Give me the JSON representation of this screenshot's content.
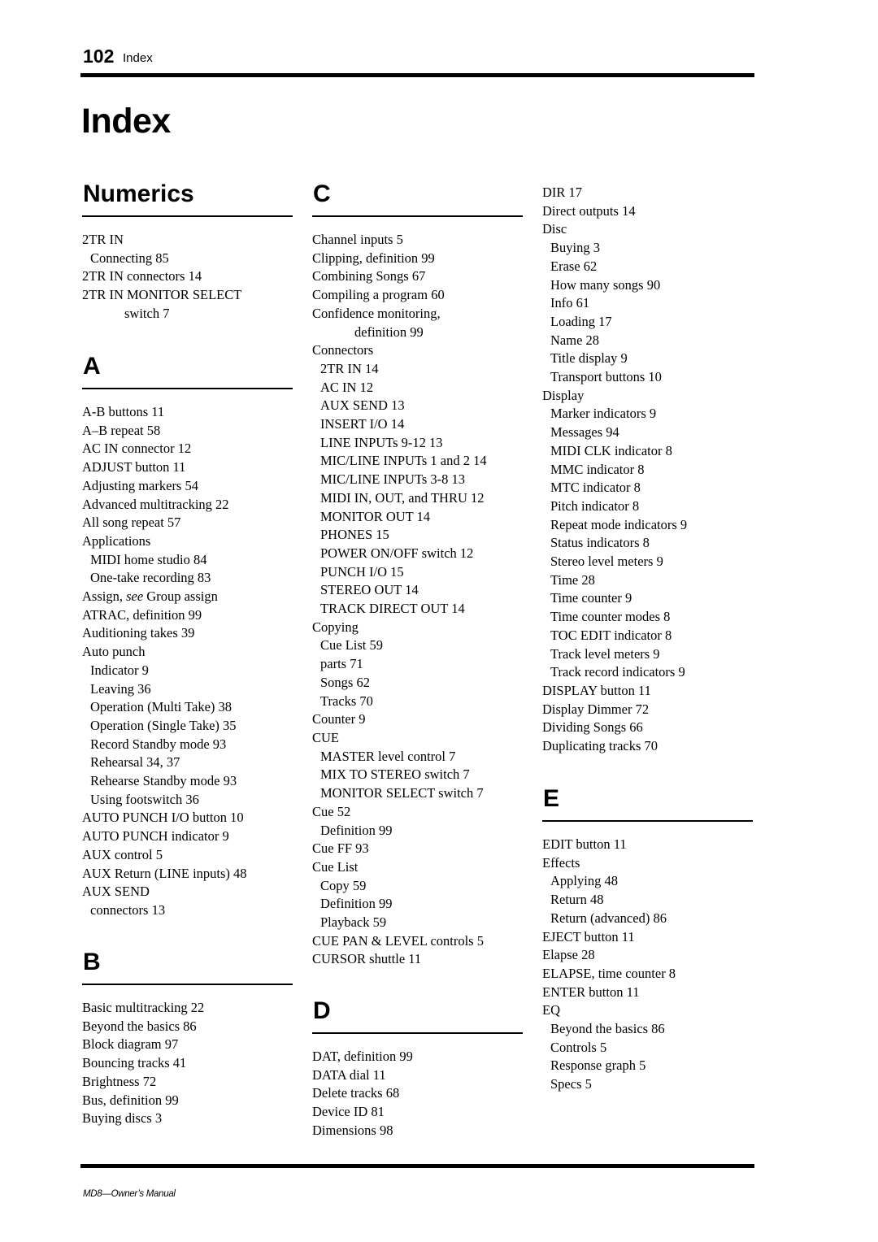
{
  "header": {
    "page_number": "102",
    "section_label": "Index"
  },
  "page_title": "Index",
  "footer": "MD8—Owner’s Manual",
  "sections": {
    "numerics": {
      "heading": "Numerics",
      "entries": [
        {
          "text": "2TR IN",
          "level": 0
        },
        {
          "text": "Connecting 85",
          "level": 1
        },
        {
          "text": "2TR IN connectors 14",
          "level": 0
        },
        {
          "text": "2TR IN MONITOR SELECT",
          "level": 0
        },
        {
          "text": "switch 7",
          "level": 2
        }
      ]
    },
    "a": {
      "heading": "A",
      "entries": [
        {
          "text": "A-B buttons 11",
          "level": 0
        },
        {
          "text": "A–B repeat 58",
          "level": 0
        },
        {
          "text": "AC IN connector 12",
          "level": 0
        },
        {
          "text": "ADJUST button 11",
          "level": 0
        },
        {
          "text": "Adjusting markers 54",
          "level": 0
        },
        {
          "text": "Advanced multitracking 22",
          "level": 0
        },
        {
          "text": "All song repeat 57",
          "level": 0
        },
        {
          "text": "Applications",
          "level": 0
        },
        {
          "text": "MIDI home studio 84",
          "level": 1
        },
        {
          "text": "One-take recording 83",
          "level": 1
        },
        {
          "text": "Assign, see Group assign",
          "level": 0,
          "pre": "Assign, ",
          "italic": "see",
          "post": " Group assign"
        },
        {
          "text": "ATRAC, definition 99",
          "level": 0
        },
        {
          "text": "Auditioning takes 39",
          "level": 0
        },
        {
          "text": "Auto punch",
          "level": 0
        },
        {
          "text": "Indicator 9",
          "level": 1
        },
        {
          "text": "Leaving 36",
          "level": 1
        },
        {
          "text": "Operation (Multi Take) 38",
          "level": 1
        },
        {
          "text": "Operation (Single Take) 35",
          "level": 1
        },
        {
          "text": "Record Standby mode 93",
          "level": 1
        },
        {
          "text": "Rehearsal 34, 37",
          "level": 1
        },
        {
          "text": "Rehearse Standby mode 93",
          "level": 1
        },
        {
          "text": "Using footswitch 36",
          "level": 1
        },
        {
          "text": "AUTO PUNCH I/O button 10",
          "level": 0
        },
        {
          "text": "AUTO PUNCH indicator 9",
          "level": 0
        },
        {
          "text": "AUX control 5",
          "level": 0
        },
        {
          "text": "AUX Return (LINE inputs) 48",
          "level": 0
        },
        {
          "text": "AUX SEND",
          "level": 0
        },
        {
          "text": "connectors 13",
          "level": 1
        }
      ]
    },
    "b": {
      "heading": "B",
      "entries": [
        {
          "text": "Basic multitracking 22",
          "level": 0
        },
        {
          "text": "Beyond the basics 86",
          "level": 0
        },
        {
          "text": "Block diagram 97",
          "level": 0
        },
        {
          "text": "Bouncing tracks 41",
          "level": 0
        },
        {
          "text": "Brightness 72",
          "level": 0
        },
        {
          "text": "Bus, definition 99",
          "level": 0
        },
        {
          "text": "Buying discs 3",
          "level": 0
        }
      ]
    },
    "c": {
      "heading": "C",
      "entries": [
        {
          "text": "Channel inputs 5",
          "level": 0
        },
        {
          "text": "Clipping, definition 99",
          "level": 0
        },
        {
          "text": "Combining Songs 67",
          "level": 0
        },
        {
          "text": "Compiling a program 60",
          "level": 0
        },
        {
          "text": "Confidence monitoring,",
          "level": 0
        },
        {
          "text": "definition 99",
          "level": 2
        },
        {
          "text": "Connectors",
          "level": 0
        },
        {
          "text": "2TR IN 14",
          "level": 1
        },
        {
          "text": "AC IN 12",
          "level": 1
        },
        {
          "text": "AUX SEND 13",
          "level": 1
        },
        {
          "text": "INSERT I/O 14",
          "level": 1
        },
        {
          "text": "LINE INPUTs 9-12 13",
          "level": 1
        },
        {
          "text": "MIC/LINE INPUTs 1 and 2 14",
          "level": 1
        },
        {
          "text": "MIC/LINE INPUTs 3-8 13",
          "level": 1
        },
        {
          "text": "MIDI IN, OUT, and THRU 12",
          "level": 1
        },
        {
          "text": "MONITOR OUT 14",
          "level": 1
        },
        {
          "text": "PHONES 15",
          "level": 1
        },
        {
          "text": "POWER ON/OFF switch 12",
          "level": 1
        },
        {
          "text": "PUNCH I/O 15",
          "level": 1
        },
        {
          "text": "STEREO OUT 14",
          "level": 1
        },
        {
          "text": "TRACK DIRECT OUT 14",
          "level": 1
        },
        {
          "text": "Copying",
          "level": 0
        },
        {
          "text": "Cue List 59",
          "level": 1
        },
        {
          "text": "parts 71",
          "level": 1
        },
        {
          "text": "Songs 62",
          "level": 1
        },
        {
          "text": "Tracks 70",
          "level": 1
        },
        {
          "text": "Counter 9",
          "level": 0
        },
        {
          "text": "CUE",
          "level": 0
        },
        {
          "text": "MASTER level control 7",
          "level": 1
        },
        {
          "text": "MIX TO STEREO switch 7",
          "level": 1
        },
        {
          "text": "MONITOR SELECT switch 7",
          "level": 1
        },
        {
          "text": "Cue 52",
          "level": 0
        },
        {
          "text": "Definition 99",
          "level": 1
        },
        {
          "text": "Cue FF 93",
          "level": 0
        },
        {
          "text": "Cue List",
          "level": 0
        },
        {
          "text": "Copy 59",
          "level": 1
        },
        {
          "text": "Definition 99",
          "level": 1
        },
        {
          "text": "Playback 59",
          "level": 1
        },
        {
          "text": "CUE PAN & LEVEL controls 5",
          "level": 0
        },
        {
          "text": "CURSOR shuttle 11",
          "level": 0
        }
      ]
    },
    "d": {
      "heading": "D",
      "entries": [
        {
          "text": "DAT, definition 99",
          "level": 0
        },
        {
          "text": "DATA dial 11",
          "level": 0
        },
        {
          "text": "Delete tracks 68",
          "level": 0
        },
        {
          "text": "Device ID 81",
          "level": 0
        },
        {
          "text": "Dimensions 98",
          "level": 0
        }
      ]
    },
    "d_continued": {
      "entries": [
        {
          "text": "DIR 17",
          "level": 0
        },
        {
          "text": "Direct outputs 14",
          "level": 0
        },
        {
          "text": "Disc",
          "level": 0
        },
        {
          "text": "Buying 3",
          "level": 1
        },
        {
          "text": "Erase 62",
          "level": 1
        },
        {
          "text": "How many songs 90",
          "level": 1
        },
        {
          "text": "Info 61",
          "level": 1
        },
        {
          "text": "Loading 17",
          "level": 1
        },
        {
          "text": "Name 28",
          "level": 1
        },
        {
          "text": "Title display 9",
          "level": 1
        },
        {
          "text": "Transport buttons 10",
          "level": 1
        },
        {
          "text": "Display",
          "level": 0
        },
        {
          "text": "Marker indicators 9",
          "level": 1
        },
        {
          "text": "Messages 94",
          "level": 1
        },
        {
          "text": "MIDI CLK indicator 8",
          "level": 1
        },
        {
          "text": "MMC indicator 8",
          "level": 1
        },
        {
          "text": "MTC indicator 8",
          "level": 1
        },
        {
          "text": "Pitch indicator 8",
          "level": 1
        },
        {
          "text": "Repeat mode indicators 9",
          "level": 1
        },
        {
          "text": "Status indicators 8",
          "level": 1
        },
        {
          "text": "Stereo level meters 9",
          "level": 1
        },
        {
          "text": "Time 28",
          "level": 1
        },
        {
          "text": "Time counter 9",
          "level": 1
        },
        {
          "text": "Time counter modes 8",
          "level": 1
        },
        {
          "text": "TOC EDIT indicator 8",
          "level": 1
        },
        {
          "text": "Track level meters 9",
          "level": 1
        },
        {
          "text": "Track record indicators 9",
          "level": 1
        },
        {
          "text": "DISPLAY button 11",
          "level": 0
        },
        {
          "text": "Display Dimmer 72",
          "level": 0
        },
        {
          "text": "Dividing Songs 66",
          "level": 0
        },
        {
          "text": "Duplicating tracks 70",
          "level": 0
        }
      ]
    },
    "e": {
      "heading": "E",
      "entries": [
        {
          "text": "EDIT button 11",
          "level": 0
        },
        {
          "text": "Effects",
          "level": 0
        },
        {
          "text": "Applying 48",
          "level": 1
        },
        {
          "text": "Return 48",
          "level": 1
        },
        {
          "text": "Return (advanced) 86",
          "level": 1
        },
        {
          "text": "EJECT button 11",
          "level": 0
        },
        {
          "text": "Elapse 28",
          "level": 0
        },
        {
          "text": "ELAPSE, time counter 8",
          "level": 0
        },
        {
          "text": "ENTER button 11",
          "level": 0
        },
        {
          "text": "EQ",
          "level": 0
        },
        {
          "text": "Beyond the basics 86",
          "level": 1
        },
        {
          "text": "Controls 5",
          "level": 1
        },
        {
          "text": "Response graph 5",
          "level": 1
        },
        {
          "text": "Specs 5",
          "level": 1
        }
      ]
    }
  }
}
